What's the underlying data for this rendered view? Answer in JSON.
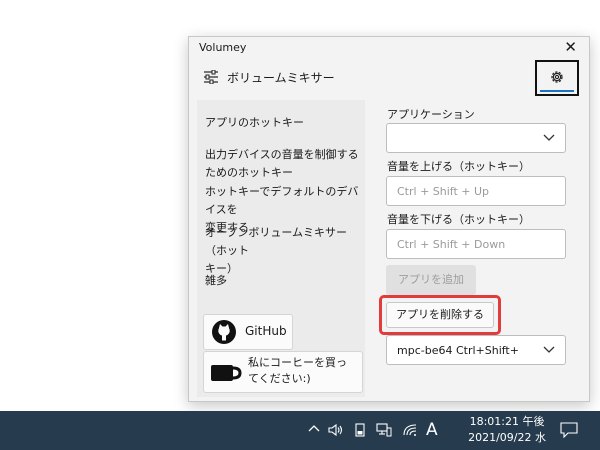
{
  "window": {
    "title": "Volumey",
    "close_glyph": "✕"
  },
  "header": {
    "title": "ボリュームミキサー",
    "icon": "sliders-icon",
    "settings_icon": "gear-icon"
  },
  "left_panel": {
    "section_title": "アプリのホットキー",
    "items": [
      "出力デバイスの音量を制御する\nためのホットキー",
      "ホットキーでデフォルトのデバイスを\n変更する",
      "オープンボリュームミキサー（ホット\nキー）",
      "雑多"
    ],
    "github_label": "GitHub",
    "coffee_label": "私にコーヒーを買ってください:)"
  },
  "right_panel": {
    "application_label": "アプリケーション",
    "application_value": "",
    "volume_up_label": "音量を上げる（ホットキー）",
    "volume_up_placeholder": "Ctrl + Shift + Up",
    "volume_down_label": "音量を下げる（ホットキー）",
    "volume_down_placeholder": "Ctrl + Shift + Down",
    "add_app_label": "アプリを追加",
    "remove_app_label": "アプリを削除する",
    "app_list_value": "mpc-be64   Ctrl+Shift+"
  },
  "taskbar": {
    "time": "18:01:21 午後",
    "date": "2021/09/22 水",
    "ime_label": "A"
  },
  "colors": {
    "taskbar": "#263b4d",
    "accent": "#1a73c7",
    "highlight": "#e23b3b"
  }
}
